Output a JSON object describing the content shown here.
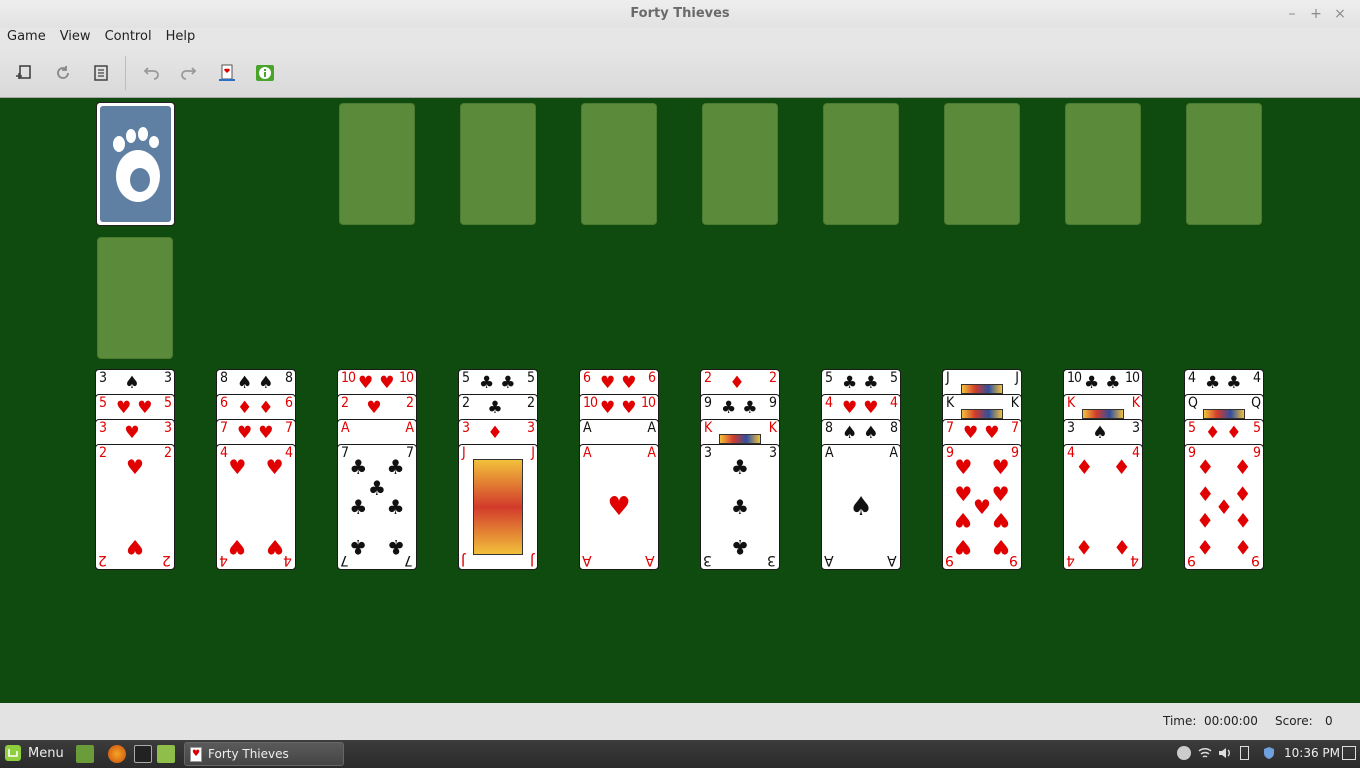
{
  "window": {
    "title": "Forty Thieves",
    "minimize": "–",
    "maximize": "+",
    "close": "×"
  },
  "menu": [
    "Game",
    "View",
    "Control",
    "Help"
  ],
  "toolbar": {
    "buttons": [
      "new-game-icon",
      "restart-icon",
      "statistics-icon",
      "undo-icon",
      "redo-icon",
      "deal-icon",
      "hint-icon"
    ]
  },
  "board": {
    "background": "#0f4a0f",
    "foundations_empty": 8,
    "tableau": [
      {
        "stack": [
          [
            "3",
            "♠",
            "blk"
          ],
          [
            "5",
            "♥",
            "red"
          ],
          [
            "3",
            "♥",
            "red"
          ]
        ],
        "top": [
          "2",
          "♥",
          "red"
        ]
      },
      {
        "stack": [
          [
            "8",
            "♠",
            "blk"
          ],
          [
            "6",
            "♦",
            "red"
          ],
          [
            "7",
            "♥",
            "red"
          ]
        ],
        "top": [
          "4",
          "♥",
          "red"
        ]
      },
      {
        "stack": [
          [
            "10",
            "♥",
            "red"
          ],
          [
            "2",
            "♥",
            "red"
          ],
          [
            "A",
            "♦",
            "red"
          ]
        ],
        "top": [
          "7",
          "♣",
          "blk"
        ]
      },
      {
        "stack": [
          [
            "5",
            "♣",
            "blk"
          ],
          [
            "2",
            "♣",
            "blk"
          ],
          [
            "3",
            "♦",
            "red"
          ]
        ],
        "top": [
          "J",
          "♦",
          "red"
        ]
      },
      {
        "stack": [
          [
            "6",
            "♥",
            "red"
          ],
          [
            "10",
            "♥",
            "red"
          ],
          [
            "A",
            "♣",
            "blk"
          ]
        ],
        "top": [
          "A",
          "♥",
          "red"
        ]
      },
      {
        "stack": [
          [
            "2",
            "♦",
            "red"
          ],
          [
            "9",
            "♣",
            "blk"
          ],
          [
            "K",
            "♦",
            "red"
          ]
        ],
        "top": [
          "3",
          "♣",
          "blk"
        ]
      },
      {
        "stack": [
          [
            "5",
            "♣",
            "blk"
          ],
          [
            "4",
            "♥",
            "red"
          ],
          [
            "8",
            "♠",
            "blk"
          ]
        ],
        "top": [
          "A",
          "♠",
          "blk"
        ]
      },
      {
        "stack": [
          [
            "J",
            "♠",
            "blk"
          ],
          [
            "K",
            "♠",
            "blk"
          ],
          [
            "7",
            "♥",
            "red"
          ]
        ],
        "top": [
          "9",
          "♥",
          "red"
        ]
      },
      {
        "stack": [
          [
            "10",
            "♣",
            "blk"
          ],
          [
            "K",
            "♦",
            "red"
          ],
          [
            "3",
            "♠",
            "blk"
          ]
        ],
        "top": [
          "4",
          "♦",
          "red"
        ]
      },
      {
        "stack": [
          [
            "4",
            "♣",
            "blk"
          ],
          [
            "Q",
            "♠",
            "blk"
          ],
          [
            "5",
            "♦",
            "red"
          ]
        ],
        "top": [
          "9",
          "♦",
          "red"
        ]
      }
    ]
  },
  "status": {
    "time_label": "Time:",
    "time_value": "00:00:00",
    "score_label": "Score:",
    "score_value": "0"
  },
  "taskbar": {
    "menu_label": "Menu",
    "task_label": "Forty Thieves",
    "clock": "10:36 PM"
  }
}
